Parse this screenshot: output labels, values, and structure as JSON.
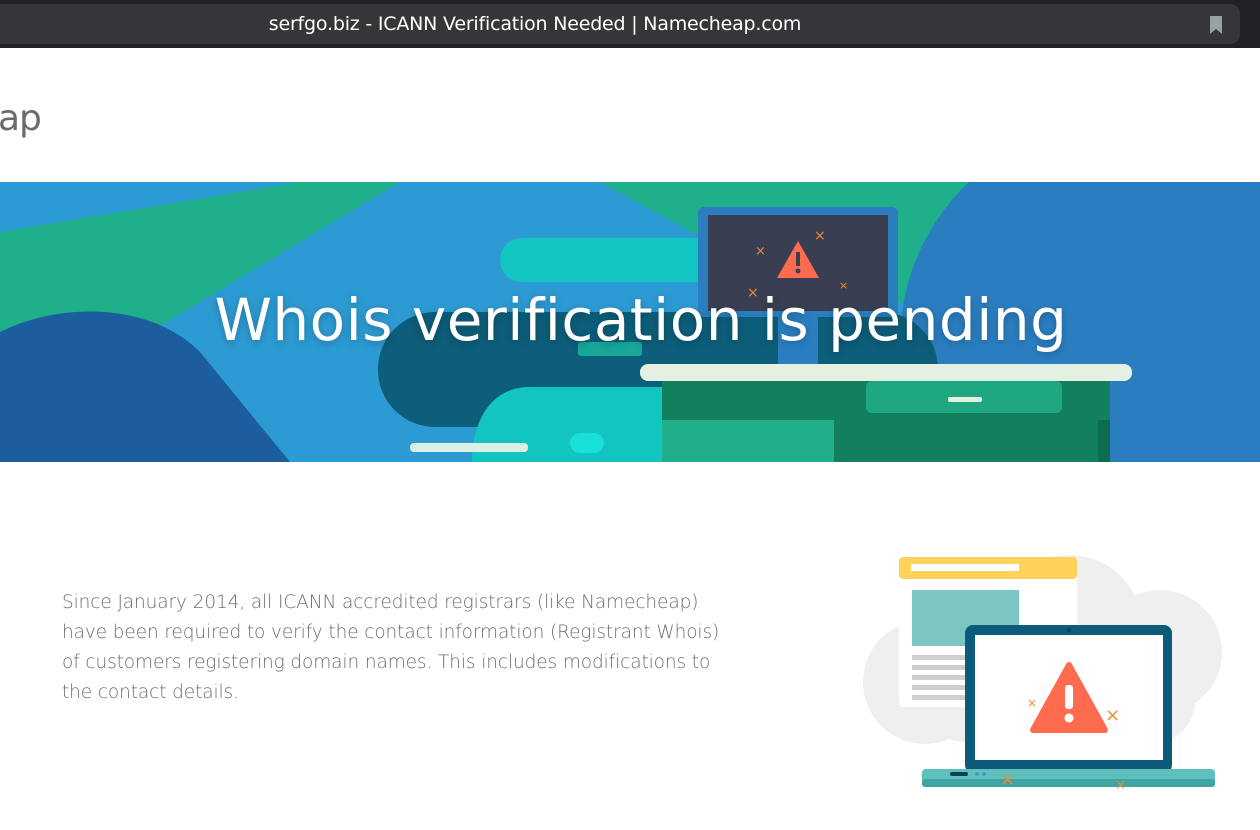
{
  "browser": {
    "tab_title": "serfgo.biz - ICANN Verification Needed | Namecheap.com",
    "icons": [
      "bookmark-icon"
    ]
  },
  "header": {
    "logo_fragment": "ap"
  },
  "hero": {
    "title": "Whois verification is pending",
    "illustration": [
      "monitor-icon",
      "warning-icon",
      "desk-illustration"
    ]
  },
  "main": {
    "intro_text": "Since January 2014, all ICANN accredited registrars (like Namecheap) have been required to verify the contact information (Registrant Whois) of customers registering domain names. This includes modifications to the contact details.",
    "illustration": [
      "cloud-icon",
      "document-icon",
      "laptop-icon",
      "warning-icon"
    ]
  },
  "colors": {
    "titlebar": "#202124",
    "hero_blue": "#2d9bd3",
    "hero_green": "#1fb08b",
    "hero_dark": "#0d5e7a",
    "teal": "#12c5c0",
    "warning": "#ff6b4f",
    "accent_orange": "#f08c2f",
    "yellow": "#ffd25a",
    "text": "#6e6e6e"
  }
}
